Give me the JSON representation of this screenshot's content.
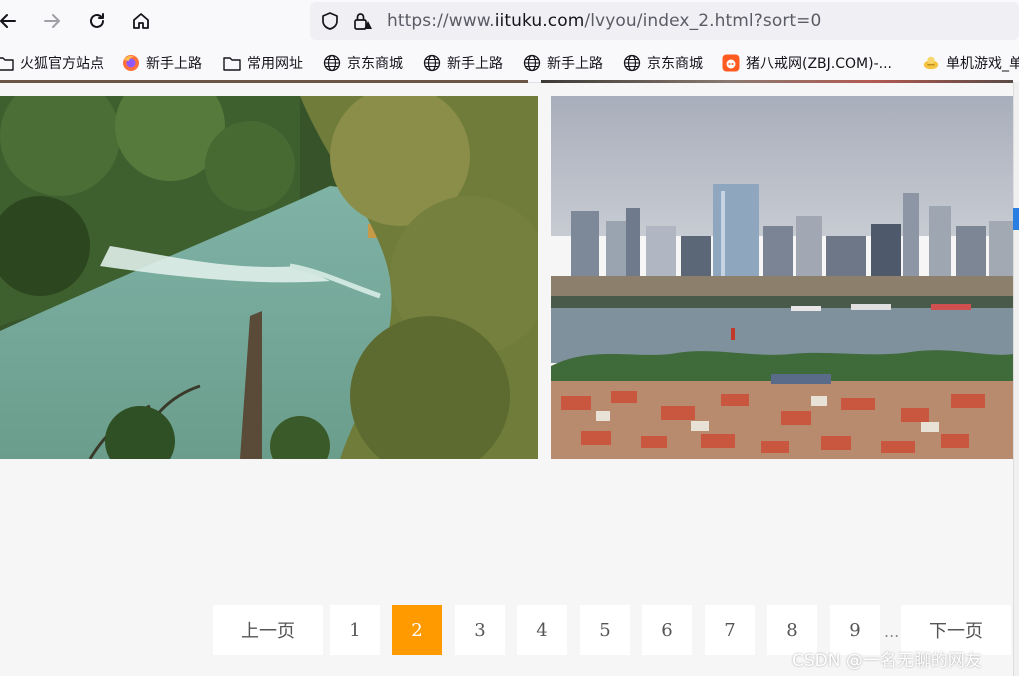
{
  "browser": {
    "url_prefix": "https://www.",
    "url_host": "iituku.com",
    "url_path": "/lvyou/index_2.html?sort=0"
  },
  "bookmarks": [
    {
      "label": "火狐官方站点",
      "icon": "folder-icon"
    },
    {
      "label": "新手上路",
      "icon": "firefox-icon"
    },
    {
      "label": "常用网址",
      "icon": "folder-icon"
    },
    {
      "label": "京东商城",
      "icon": "globe-icon"
    },
    {
      "label": "新手上路",
      "icon": "globe-icon"
    },
    {
      "label": "新手上路",
      "icon": "globe-icon"
    },
    {
      "label": "京东商城",
      "icon": "globe-icon"
    },
    {
      "label": "猪八戒网(ZBJ.COM)-...",
      "icon": "zbj-icon"
    },
    {
      "label": "单机游戏_单",
      "icon": "game-icon"
    }
  ],
  "pagination": {
    "prev": "上一页",
    "pages": [
      "1",
      "2",
      "3",
      "4",
      "5",
      "6",
      "7",
      "8",
      "9"
    ],
    "current": "2",
    "ellipsis": "...",
    "next": "下一页"
  },
  "watermark": "CSDN @一名无聊的网友",
  "colors": {
    "active_page": "#ff9b00",
    "page_bg": "#f6f6f6"
  }
}
